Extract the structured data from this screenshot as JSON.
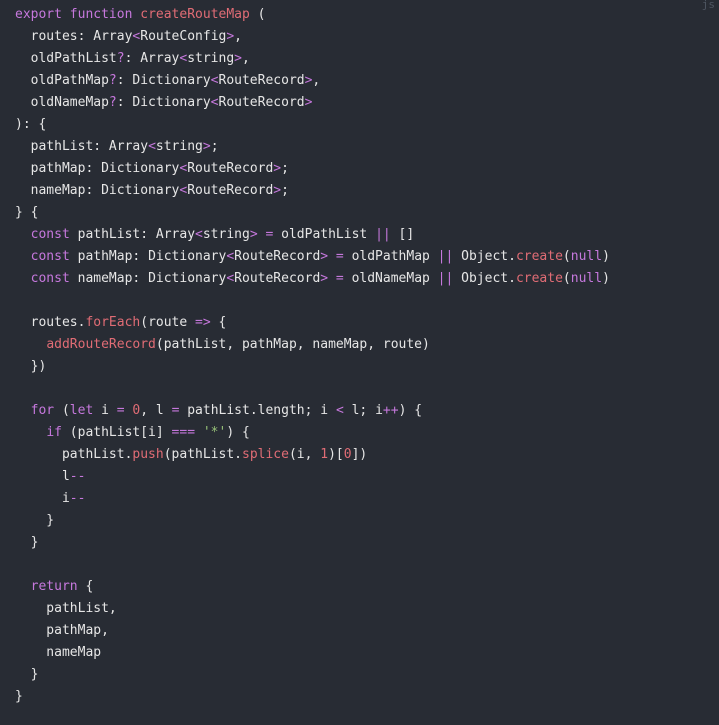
{
  "code_block": {
    "language_label": "js",
    "lines": [
      [
        {
          "t": "export ",
          "c": "kw"
        },
        {
          "t": "function ",
          "c": "kw"
        },
        {
          "t": "createRouteMap",
          "c": "fn"
        },
        {
          "t": " (",
          "c": "pl"
        }
      ],
      [
        {
          "t": "  routes",
          "c": "pl"
        },
        {
          "t": ": ",
          "c": "pl"
        },
        {
          "t": "Array",
          "c": "pl"
        },
        {
          "t": "<",
          "c": "op"
        },
        {
          "t": "RouteConfig",
          "c": "pl"
        },
        {
          "t": ">",
          "c": "op"
        },
        {
          "t": ",",
          "c": "pl"
        }
      ],
      [
        {
          "t": "  oldPathList",
          "c": "pl"
        },
        {
          "t": "?",
          "c": "op"
        },
        {
          "t": ": Array",
          "c": "pl"
        },
        {
          "t": "<",
          "c": "op"
        },
        {
          "t": "string",
          "c": "pl"
        },
        {
          "t": ">",
          "c": "op"
        },
        {
          "t": ",",
          "c": "pl"
        }
      ],
      [
        {
          "t": "  oldPathMap",
          "c": "pl"
        },
        {
          "t": "?",
          "c": "op"
        },
        {
          "t": ": Dictionary",
          "c": "pl"
        },
        {
          "t": "<",
          "c": "op"
        },
        {
          "t": "RouteRecord",
          "c": "pl"
        },
        {
          "t": ">",
          "c": "op"
        },
        {
          "t": ",",
          "c": "pl"
        }
      ],
      [
        {
          "t": "  oldNameMap",
          "c": "pl"
        },
        {
          "t": "?",
          "c": "op"
        },
        {
          "t": ": Dictionary",
          "c": "pl"
        },
        {
          "t": "<",
          "c": "op"
        },
        {
          "t": "RouteRecord",
          "c": "pl"
        },
        {
          "t": ">",
          "c": "op"
        }
      ],
      [
        {
          "t": "): {",
          "c": "pl"
        }
      ],
      [
        {
          "t": "  pathList: Array",
          "c": "pl"
        },
        {
          "t": "<",
          "c": "op"
        },
        {
          "t": "string",
          "c": "pl"
        },
        {
          "t": ">",
          "c": "op"
        },
        {
          "t": ";",
          "c": "pl"
        }
      ],
      [
        {
          "t": "  pathMap: Dictionary",
          "c": "pl"
        },
        {
          "t": "<",
          "c": "op"
        },
        {
          "t": "RouteRecord",
          "c": "pl"
        },
        {
          "t": ">",
          "c": "op"
        },
        {
          "t": ";",
          "c": "pl"
        }
      ],
      [
        {
          "t": "  nameMap: Dictionary",
          "c": "pl"
        },
        {
          "t": "<",
          "c": "op"
        },
        {
          "t": "RouteRecord",
          "c": "pl"
        },
        {
          "t": ">",
          "c": "op"
        },
        {
          "t": ";",
          "c": "pl"
        }
      ],
      [
        {
          "t": "} {",
          "c": "pl"
        }
      ],
      [
        {
          "t": "  ",
          "c": "pl"
        },
        {
          "t": "const ",
          "c": "kw"
        },
        {
          "t": "pathList: Array",
          "c": "pl"
        },
        {
          "t": "<",
          "c": "op"
        },
        {
          "t": "string",
          "c": "pl"
        },
        {
          "t": ">",
          "c": "op"
        },
        {
          "t": " ",
          "c": "pl"
        },
        {
          "t": "=",
          "c": "op"
        },
        {
          "t": " oldPathList ",
          "c": "pl"
        },
        {
          "t": "||",
          "c": "op"
        },
        {
          "t": " []",
          "c": "pl"
        }
      ],
      [
        {
          "t": "  ",
          "c": "pl"
        },
        {
          "t": "const ",
          "c": "kw"
        },
        {
          "t": "pathMap: Dictionary",
          "c": "pl"
        },
        {
          "t": "<",
          "c": "op"
        },
        {
          "t": "RouteRecord",
          "c": "pl"
        },
        {
          "t": ">",
          "c": "op"
        },
        {
          "t": " ",
          "c": "pl"
        },
        {
          "t": "=",
          "c": "op"
        },
        {
          "t": " oldPathMap ",
          "c": "pl"
        },
        {
          "t": "||",
          "c": "op"
        },
        {
          "t": " Object.",
          "c": "pl"
        },
        {
          "t": "create",
          "c": "fn"
        },
        {
          "t": "(",
          "c": "pl"
        },
        {
          "t": "null",
          "c": "kw"
        },
        {
          "t": ")",
          "c": "pl"
        }
      ],
      [
        {
          "t": "  ",
          "c": "pl"
        },
        {
          "t": "const ",
          "c": "kw"
        },
        {
          "t": "nameMap: Dictionary",
          "c": "pl"
        },
        {
          "t": "<",
          "c": "op"
        },
        {
          "t": "RouteRecord",
          "c": "pl"
        },
        {
          "t": ">",
          "c": "op"
        },
        {
          "t": " ",
          "c": "pl"
        },
        {
          "t": "=",
          "c": "op"
        },
        {
          "t": " oldNameMap ",
          "c": "pl"
        },
        {
          "t": "||",
          "c": "op"
        },
        {
          "t": " Object.",
          "c": "pl"
        },
        {
          "t": "create",
          "c": "fn"
        },
        {
          "t": "(",
          "c": "pl"
        },
        {
          "t": "null",
          "c": "kw"
        },
        {
          "t": ")",
          "c": "pl"
        }
      ],
      [
        {
          "t": "",
          "c": "pl"
        }
      ],
      [
        {
          "t": "  routes.",
          "c": "pl"
        },
        {
          "t": "forEach",
          "c": "fn"
        },
        {
          "t": "(route ",
          "c": "pl"
        },
        {
          "t": "=>",
          "c": "op"
        },
        {
          "t": " {",
          "c": "pl"
        }
      ],
      [
        {
          "t": "    ",
          "c": "pl"
        },
        {
          "t": "addRouteRecord",
          "c": "fn"
        },
        {
          "t": "(pathList, pathMap, nameMap, route)",
          "c": "pl"
        }
      ],
      [
        {
          "t": "  })",
          "c": "pl"
        }
      ],
      [
        {
          "t": "",
          "c": "pl"
        }
      ],
      [
        {
          "t": "  ",
          "c": "pl"
        },
        {
          "t": "for",
          "c": "kw"
        },
        {
          "t": " (",
          "c": "pl"
        },
        {
          "t": "let",
          "c": "kw"
        },
        {
          "t": " i ",
          "c": "pl"
        },
        {
          "t": "=",
          "c": "op"
        },
        {
          "t": " ",
          "c": "pl"
        },
        {
          "t": "0",
          "c": "num"
        },
        {
          "t": ", l ",
          "c": "pl"
        },
        {
          "t": "=",
          "c": "op"
        },
        {
          "t": " pathList.length; i ",
          "c": "pl"
        },
        {
          "t": "<",
          "c": "op"
        },
        {
          "t": " l; i",
          "c": "pl"
        },
        {
          "t": "++",
          "c": "op"
        },
        {
          "t": ") {",
          "c": "pl"
        }
      ],
      [
        {
          "t": "    ",
          "c": "pl"
        },
        {
          "t": "if",
          "c": "kw"
        },
        {
          "t": " (pathList[i] ",
          "c": "pl"
        },
        {
          "t": "===",
          "c": "op"
        },
        {
          "t": " ",
          "c": "pl"
        },
        {
          "t": "'*'",
          "c": "str"
        },
        {
          "t": ") {",
          "c": "pl"
        }
      ],
      [
        {
          "t": "      pathList.",
          "c": "pl"
        },
        {
          "t": "push",
          "c": "fn"
        },
        {
          "t": "(pathList.",
          "c": "pl"
        },
        {
          "t": "splice",
          "c": "fn"
        },
        {
          "t": "(i, ",
          "c": "pl"
        },
        {
          "t": "1",
          "c": "num"
        },
        {
          "t": ")[",
          "c": "pl"
        },
        {
          "t": "0",
          "c": "num"
        },
        {
          "t": "])",
          "c": "pl"
        }
      ],
      [
        {
          "t": "      l",
          "c": "pl"
        },
        {
          "t": "--",
          "c": "op"
        }
      ],
      [
        {
          "t": "      i",
          "c": "pl"
        },
        {
          "t": "--",
          "c": "op"
        }
      ],
      [
        {
          "t": "    }",
          "c": "pl"
        }
      ],
      [
        {
          "t": "  }",
          "c": "pl"
        }
      ],
      [
        {
          "t": "",
          "c": "pl"
        }
      ],
      [
        {
          "t": "  ",
          "c": "pl"
        },
        {
          "t": "return",
          "c": "kw"
        },
        {
          "t": " {",
          "c": "pl"
        }
      ],
      [
        {
          "t": "    pathList,",
          "c": "pl"
        }
      ],
      [
        {
          "t": "    pathMap,",
          "c": "pl"
        }
      ],
      [
        {
          "t": "    nameMap",
          "c": "pl"
        }
      ],
      [
        {
          "t": "  }",
          "c": "pl"
        }
      ],
      [
        {
          "t": "}",
          "c": "pl"
        }
      ]
    ]
  },
  "colors": {
    "background": "#282c34",
    "keyword": "#c678dd",
    "function": "#e06c75",
    "string": "#98c379",
    "number": "#e06c75",
    "plain": "#e6e6e6"
  }
}
